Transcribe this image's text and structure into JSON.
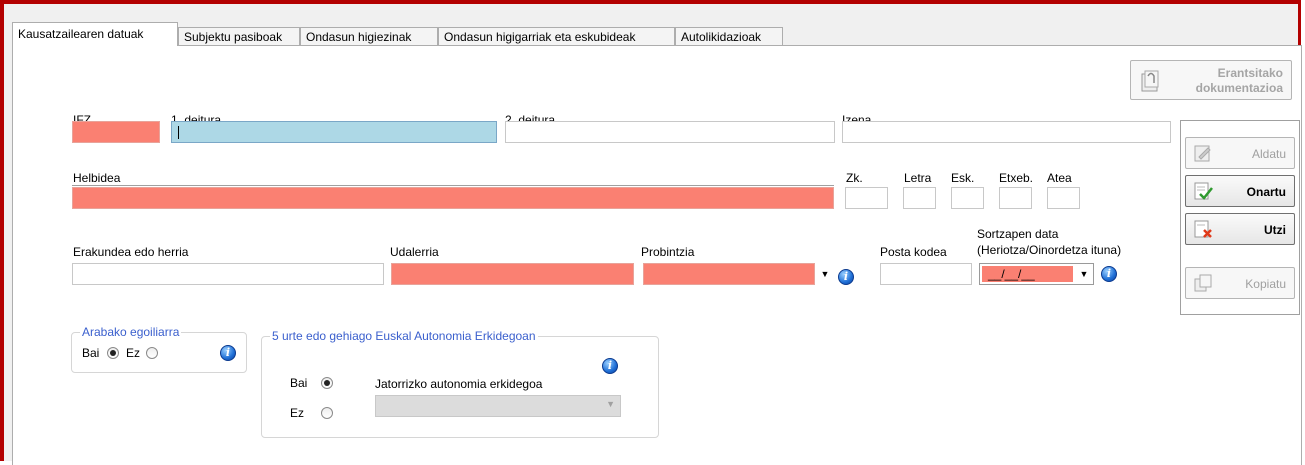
{
  "tabs": [
    {
      "label": "Kausatzailearen datuak",
      "active": true
    },
    {
      "label": "Subjektu pasiboak",
      "active": false
    },
    {
      "label": "Ondasun higiezinak",
      "active": false
    },
    {
      "label": "Ondasun higigarriak eta eskubideak",
      "active": false
    },
    {
      "label": "Autolikidazioak",
      "active": false
    }
  ],
  "buttons": {
    "documentation_line1": "Erantsitako",
    "documentation_line2": "dokumentazioa",
    "modify": "Aldatu",
    "accept": "Onartu",
    "exit": "Utzi",
    "copy": "Kopiatu"
  },
  "form": {
    "ifz_label": "IFZ",
    "first_surname_label": "1. deitura",
    "second_surname_label": "2. deitura",
    "name_label": "Izena",
    "address_label": "Helbidea",
    "number_label": "Zk.",
    "letter_label": "Letra",
    "stair_label": "Esk.",
    "floor_label": "Etxeb.",
    "door_label": "Atea",
    "entity_label": "Erakundea edo herria",
    "municipality_label": "Udalerria",
    "province_label": "Probintzia",
    "postcode_label": "Posta kodea",
    "date_label_line1": "Sortzapen data",
    "date_label_line2": "(Heriotza/Oinordetza ituna)",
    "date_mask": "__/__/__"
  },
  "araba": {
    "title": "Arabako egoiliarra",
    "yes": "Bai",
    "no": "Ez",
    "selected": "Bai"
  },
  "basque_residence": {
    "title": "5 urte edo gehiago Euskal Autonomia Erkidegoan",
    "yes": "Bai",
    "no": "Ez",
    "selected": "Bai",
    "origin_label": "Jatorrizko autonomia erkidegoa",
    "origin_value": ""
  },
  "colors": {
    "required": "#fa8072",
    "focused": "#add8e6",
    "frame": "#b30000",
    "group_title": "#3a5fcd"
  }
}
